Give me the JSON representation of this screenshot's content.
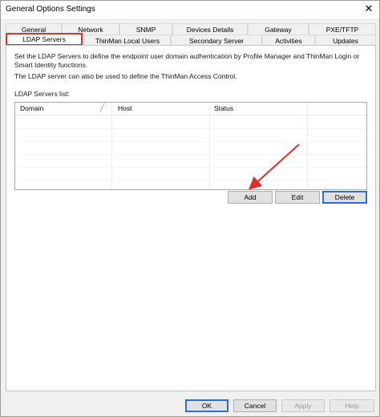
{
  "window": {
    "title": "General Options Settings",
    "close_glyph": "✕"
  },
  "tabs_back": [
    {
      "label": "General",
      "name": "tab-general"
    },
    {
      "label": "Network",
      "name": "tab-network"
    },
    {
      "label": "SNMP",
      "name": "tab-snmp"
    },
    {
      "label": "Devices Details",
      "name": "tab-devices-details"
    },
    {
      "label": "Gateway",
      "name": "tab-gateway"
    },
    {
      "label": "PXE/TFTP",
      "name": "tab-pxe-tftp"
    }
  ],
  "tabs_front": [
    {
      "label": "LDAP Servers",
      "name": "tab-ldap-servers"
    },
    {
      "label": "ThinMan Local Users",
      "name": "tab-thinman-local-users"
    },
    {
      "label": "Secondary Server",
      "name": "tab-secondary-server"
    },
    {
      "label": "Activities",
      "name": "tab-activities"
    },
    {
      "label": "Updates",
      "name": "tab-updates"
    }
  ],
  "ldap": {
    "description_1": "Set the LDAP Servers to define the endpoint user domain authentication by Profile Manager and ThinMan Login or Smart Identity functions.",
    "description_2": "The LDAP server can also be used to define the ThinMan Access Control.",
    "list_label": "LDAP Servers list:",
    "columns": [
      "Domain",
      "Host",
      "Status"
    ],
    "sort_glyph": "╱",
    "buttons": {
      "add": "Add",
      "edit": "Edit",
      "delete": "Delete"
    }
  },
  "footer": {
    "ok": "OK",
    "cancel": "Cancel",
    "apply": "Apply",
    "help": "Help"
  },
  "colors": {
    "highlight": "#e0302a",
    "arrow": "#d9302a",
    "focus": "#2a6fd6"
  }
}
